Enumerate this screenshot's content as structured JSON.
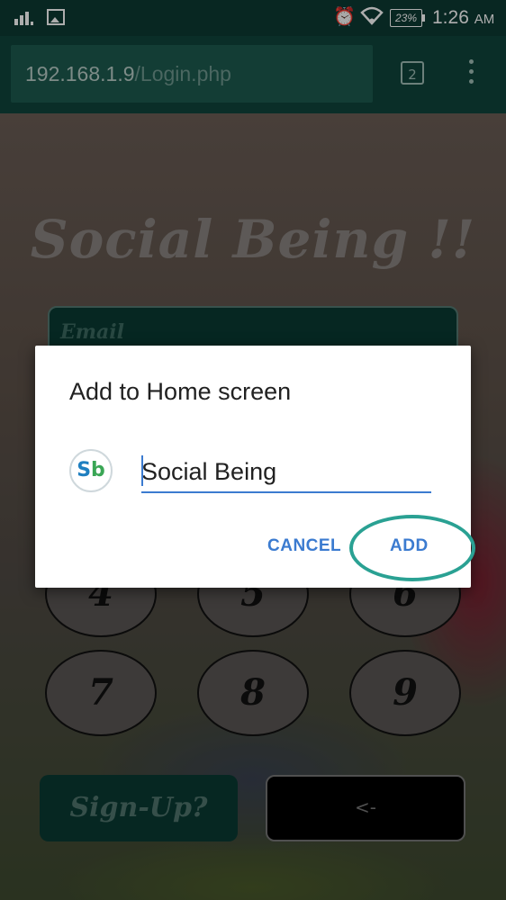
{
  "status_bar": {
    "battery": "23%",
    "time": "1:26",
    "ampm": "AM",
    "icons": [
      "signal-icon",
      "image-icon",
      "alarm-icon",
      "wifi-icon",
      "battery-icon"
    ]
  },
  "browser": {
    "url_host": "192.168.1.9",
    "url_path": "/Login.php",
    "tab_count": "2"
  },
  "page": {
    "title": "Social Being !!",
    "email_placeholder": "Email",
    "keys": [
      "4",
      "5",
      "6",
      "7",
      "8",
      "9"
    ],
    "signup_label": "Sign-Up?",
    "back_label": "<-"
  },
  "dialog": {
    "title": "Add to Home screen",
    "app_icon_text_s": "S",
    "app_icon_text_b": "b",
    "name_value": "Social Being",
    "cancel_label": "CANCEL",
    "add_label": "ADD"
  },
  "colors": {
    "status_bar": "#0d3a33",
    "toolbar": "#0f453c",
    "accent_blue": "#3b7bd0",
    "highlight_ring": "#2aa193"
  }
}
